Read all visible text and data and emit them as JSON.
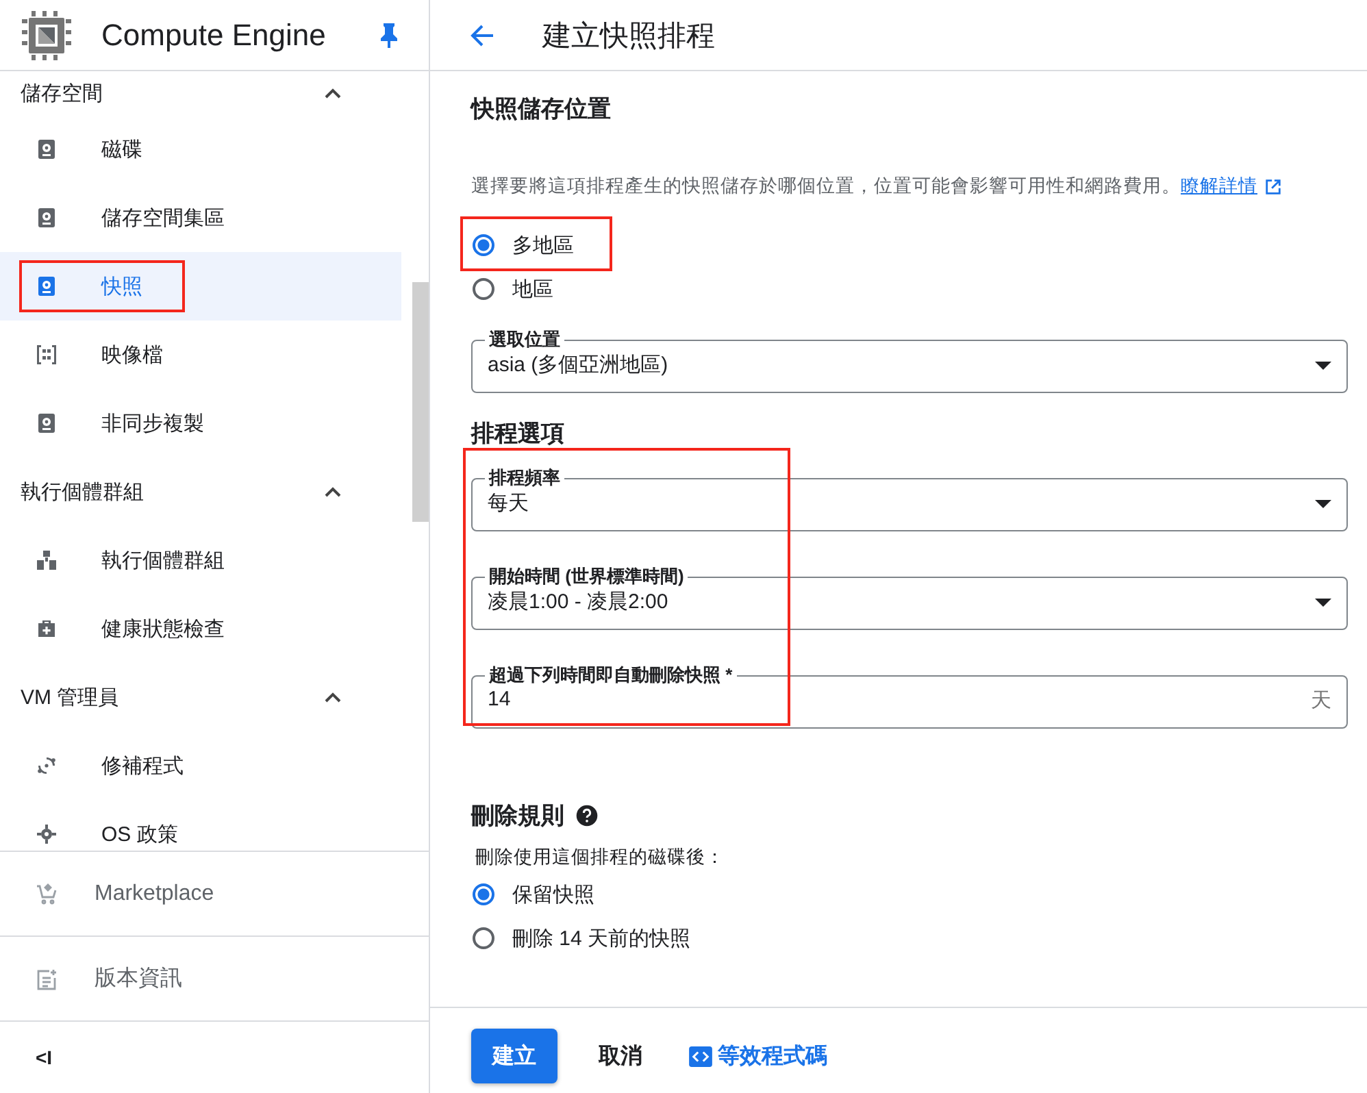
{
  "sidebar": {
    "product": "Compute Engine",
    "pinned": true,
    "groups": [
      {
        "label": "儲存空間",
        "expanded": true,
        "items": [
          {
            "label": "磁碟",
            "selected": false,
            "highlighted": false
          },
          {
            "label": "儲存空間集區",
            "selected": false,
            "highlighted": false
          },
          {
            "label": "快照",
            "selected": true,
            "highlighted": true
          },
          {
            "label": "映像檔",
            "selected": false,
            "highlighted": false
          },
          {
            "label": "非同步複製",
            "selected": false,
            "highlighted": false
          }
        ]
      },
      {
        "label": "執行個體群組",
        "expanded": true,
        "items": [
          {
            "label": "執行個體群組",
            "selected": false,
            "highlighted": false
          },
          {
            "label": "健康狀態檢查",
            "selected": false,
            "highlighted": false
          }
        ]
      },
      {
        "label": "VM 管理員",
        "expanded": true,
        "items": [
          {
            "label": "修補程式",
            "selected": false,
            "highlighted": false
          },
          {
            "label": "OS 政策",
            "selected": false,
            "highlighted": false
          }
        ]
      }
    ],
    "footer": [
      {
        "label": "Marketplace"
      },
      {
        "label": "版本資訊"
      }
    ],
    "collapse": "<I"
  },
  "page": {
    "title": "建立快照排程"
  },
  "storage_location": {
    "heading": "快照儲存位置",
    "description": "選擇要將這項排程產生的快照儲存於哪個位置，位置可能會影響可用性和網路費用。",
    "link": "瞭解詳情",
    "options": [
      {
        "label": "多地區",
        "selected": true,
        "highlighted": true
      },
      {
        "label": "地區",
        "selected": false,
        "highlighted": false
      }
    ],
    "location": {
      "label": "選取位置",
      "value": "asia (多個亞洲地區)"
    }
  },
  "schedule_options": {
    "heading": "排程選項",
    "highlighted": true,
    "fields": [
      {
        "kind": "select",
        "label": "排程頻率",
        "value": "每天"
      },
      {
        "kind": "select",
        "label": "開始時間 (世界標準時間)",
        "value": "凌晨1:00 - 凌晨2:00"
      },
      {
        "kind": "number",
        "label": "超過下列時間即自動刪除快照 *",
        "value": "14",
        "suffix": "天"
      }
    ]
  },
  "deletion_rule": {
    "heading": "刪除規則",
    "prompt": "刪除使用這個排程的磁碟後：",
    "options": [
      {
        "label": "保留快照",
        "selected": true
      },
      {
        "label": "刪除 14 天前的快照",
        "selected": false
      }
    ]
  },
  "actions": {
    "create": "建立",
    "cancel": "取消",
    "code": "等效程式碼"
  }
}
